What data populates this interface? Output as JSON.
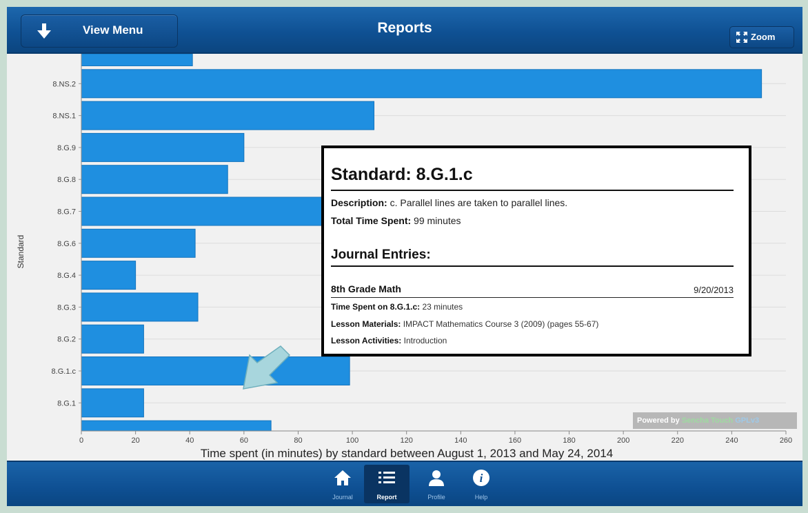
{
  "toolbar": {
    "menu_label": "View Menu",
    "title": "Reports",
    "zoom_label": "Zoom"
  },
  "colors": {
    "toolbar_blue": "#0f5194",
    "bar_blue": "#1f8fe0",
    "popup_border": "#000000",
    "pointer_arrow": "#9fd0d8"
  },
  "chart_data": {
    "type": "bar",
    "orientation": "horizontal",
    "categories": [
      "",
      "8.NS.2",
      "8.NS.1",
      "8.G.9",
      "8.G.8",
      "8.G.7",
      "8.G.6",
      "8.G.4",
      "8.G.3",
      "8.G.2",
      "8.G.1.c",
      "8.G.1",
      ""
    ],
    "values": [
      41,
      251,
      108,
      60,
      54,
      110,
      42,
      20,
      43,
      23,
      99,
      23,
      70
    ],
    "xlabel": "Time spent (in minutes) by standard between August 1, 2013 and May 24, 2014",
    "ylabel": "Standard",
    "xlim": [
      0,
      260
    ],
    "xticks": [
      0,
      20,
      40,
      60,
      80,
      100,
      120,
      140,
      160,
      180,
      200,
      220,
      240,
      260
    ],
    "grid": true
  },
  "powered_by": {
    "prefix": "Powered by",
    "product": "Sencha Touch",
    "license": "GPLv3"
  },
  "popup": {
    "title": "Standard: 8.G.1.c",
    "description_label": "Description:",
    "description": "c. Parallel lines are taken to parallel lines.",
    "total_label": "Total Time Spent:",
    "total_value": "99 minutes",
    "journal_heading": "Journal Entries:",
    "entry": {
      "title": "8th Grade Math",
      "date": "9/20/2013",
      "time_label": "Time Spent on 8.G.1.c:",
      "time_value": "23 minutes",
      "materials_label": "Lesson Materials:",
      "materials_value": "IMPACT Mathematics Course 3 (2009) (pages 55-67)",
      "activities_label": "Lesson Activities:",
      "activities_value": "Introduction"
    }
  },
  "tabbar": {
    "tabs": [
      {
        "label": "Journal",
        "icon": "home-icon"
      },
      {
        "label": "Report",
        "icon": "list-icon",
        "active": true
      },
      {
        "label": "Profile",
        "icon": "user-icon"
      },
      {
        "label": "Help",
        "icon": "info-icon"
      }
    ]
  }
}
